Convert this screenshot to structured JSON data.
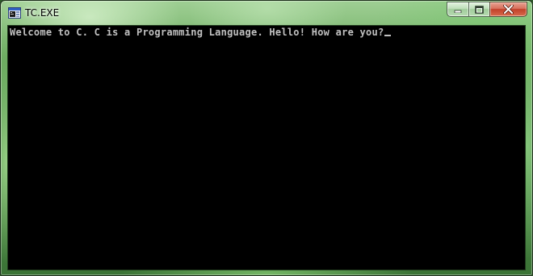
{
  "window": {
    "title": "TC.EXE",
    "icon": "dos-console-icon",
    "buttons": {
      "minimize_icon": "minimize-icon",
      "maximize_icon": "maximize-icon",
      "close_icon": "close-icon"
    }
  },
  "console": {
    "output": "Welcome to C. C is a Programming Language. Hello! How are you?",
    "cursor": "_",
    "text_color": "#c0c0c0",
    "background_color": "#000000"
  }
}
